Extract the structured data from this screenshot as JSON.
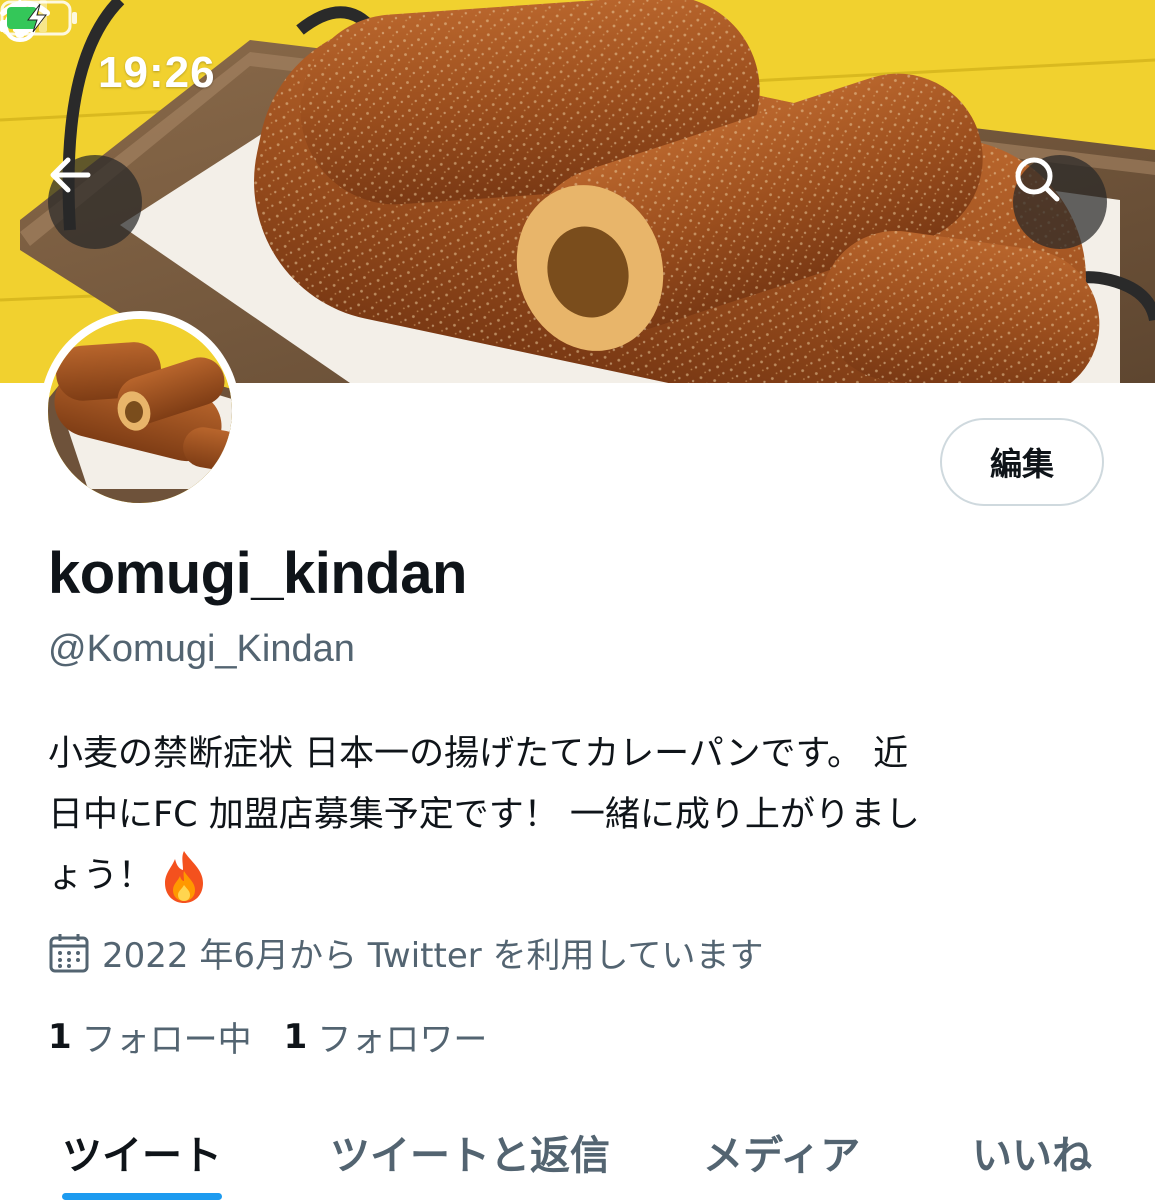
{
  "status_bar": {
    "time": "19:26",
    "icons": [
      "flame-icon",
      "signal-icon",
      "wifi-icon",
      "battery-charging-icon"
    ]
  },
  "header": {
    "back_icon": "arrow-left-icon",
    "search_icon": "search-icon"
  },
  "profile": {
    "edit_label": "編集",
    "display_name": "komugi_kindan",
    "handle": "@Komugi_Kindan",
    "bio_lines": [
      "小麦の禁断症状 日本一の揚げたてカレーパンです。 近",
      "日中にFC 加盟店募集予定です！ 一緒に成り上がりまし",
      "ょう！"
    ],
    "bio_emoji": "fire-emoji",
    "joined": "2022 年6月から Twitter を利用しています",
    "following_count": "1",
    "following_label": "フォロー中",
    "followers_count": "1",
    "followers_label": "フォロワー"
  },
  "tabs": [
    {
      "label": "ツイート",
      "active": true
    },
    {
      "label": "ツイートと返信",
      "active": false
    },
    {
      "label": "メディア",
      "active": false
    },
    {
      "label": "いいね",
      "active": false
    }
  ],
  "colors": {
    "accent": "#1d9bf0",
    "secondary_text": "#536471",
    "primary_text": "#0f1419",
    "banner_yellow": "#f2d32f"
  }
}
